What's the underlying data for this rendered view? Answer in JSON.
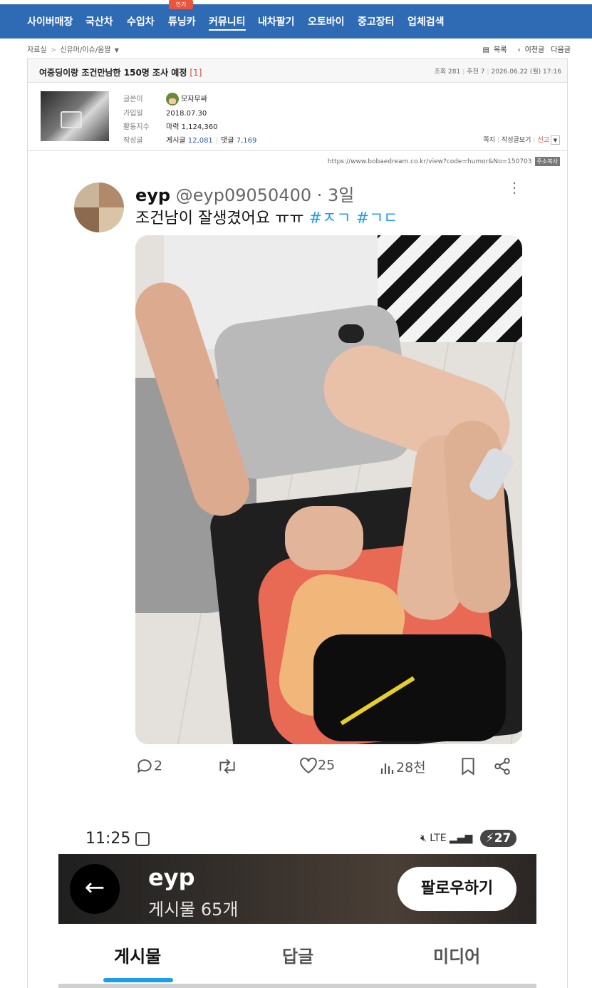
{
  "topnav": {
    "badge": "인기",
    "items": [
      "사이버매장",
      "국산차",
      "수입차",
      "튜닝카",
      "커뮤니티",
      "내차팔기",
      "오토바이",
      "중고장터",
      "업체검색"
    ],
    "active_item": "커뮤니티"
  },
  "breadcrumb": {
    "root": "자료실",
    "separator": ">",
    "current": "신유머/이슈/움짤"
  },
  "navlinks": {
    "list": "목록",
    "prev": "이전글",
    "next": "다음글"
  },
  "post": {
    "title": "여중딩이랑 조건만남한 150명 조사 예정",
    "comment_count": "[1]",
    "views_label": "조회 281",
    "recommend_label": "추천 7",
    "date": "2026.06.22 (월) 17:16"
  },
  "author": {
    "writer_label": "글쓴이",
    "writer": "모자무싸",
    "joined_label": "가입일",
    "joined": "2018.07.30",
    "activity_label": "활동지수",
    "activity": "마력 1,124,360",
    "posts_label": "작성글",
    "posts_prefix": "게시글",
    "posts_count": "12,081",
    "comments_prefix": "댓글",
    "comments_count": "7,169",
    "action_message": "쪽지",
    "action_view_posts": "작성글보기",
    "action_report": "신고"
  },
  "url": {
    "text": "https://www.bobaedream.co.kr/view?code=humor&No=150703",
    "copy_label": "주소복사"
  },
  "tweet": {
    "name": "eyp",
    "handle": "@eyp09050400",
    "age": "· 3일",
    "more": "⋮",
    "text": "조건남이 잘생겼어요 ㅠㅠ",
    "tag1": "#ㅈㄱ",
    "tag2": "#ㄱㄷ",
    "replies": "2",
    "likes": "25",
    "views": "28천"
  },
  "phone": {
    "time": "11:25",
    "network": "LTE",
    "battery": "27"
  },
  "profile": {
    "name": "eyp",
    "posts": "게시물 65개",
    "follow": "팔로우하기"
  },
  "tabs": [
    "게시물",
    "답글",
    "미디어"
  ]
}
